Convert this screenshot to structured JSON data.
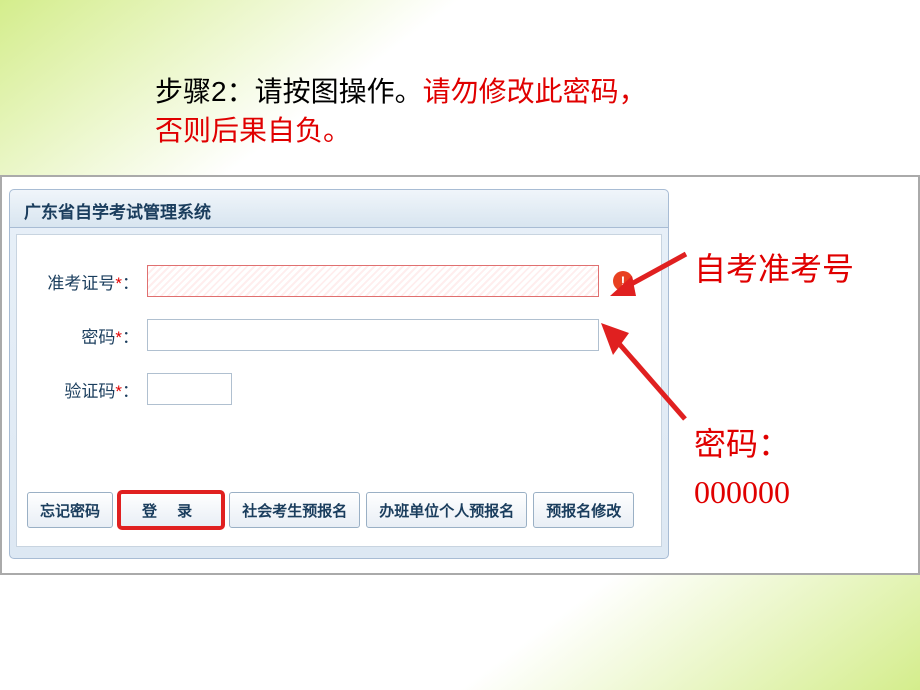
{
  "instruction": {
    "black": "步骤2：请按图操作。",
    "red_line1": "请勿修改此密码，",
    "red_line2": "否则后果自负。"
  },
  "panel": {
    "title": "广东省自学考试管理系统"
  },
  "form": {
    "id_label": "准考证号",
    "password_label": "密码",
    "captcha_label": "验证码",
    "required_mark": "*",
    "colon": "："
  },
  "buttons": {
    "forgot": "忘记密码",
    "login": "登 录",
    "social": "社会考生预报名",
    "unit": "办班单位个人预报名",
    "modify": "预报名修改"
  },
  "annotations": {
    "id_hint": "自考准考号",
    "password_hint_label": "密码：",
    "password_hint_value": "000000"
  },
  "icons": {
    "error": "!"
  }
}
